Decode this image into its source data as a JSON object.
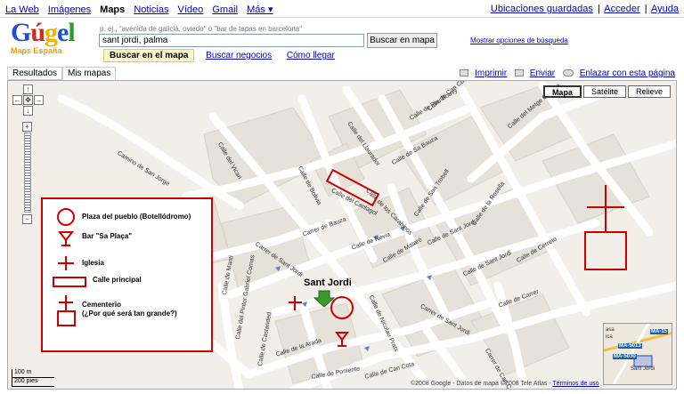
{
  "topnav": {
    "left": [
      "La Web",
      "Imágenes",
      "Maps",
      "Noticias",
      "Vídeo",
      "Gmail",
      "Más ▾"
    ],
    "right": [
      "Ubicaciones guardadas",
      "Acceder",
      "Ayuda"
    ],
    "separator": "|"
  },
  "logo": {
    "wordmark": "Gúgel",
    "sub": "Maps España"
  },
  "search": {
    "hint": "p. ej., \"avenida de galicia, oviedo\" o \"bar de tapas en barcelona\"",
    "value": "sant jordi, palma",
    "button": "Buscar en mapa",
    "options_link": "Mostrar opciones de búsqueda"
  },
  "subtabs": {
    "active": "Buscar en el mapa",
    "others": [
      "Buscar negocios",
      "Cómo llegar"
    ]
  },
  "panel_tabs": [
    "Resultados",
    "Mis mapas"
  ],
  "actions": {
    "print": "Imprimir",
    "send": "Enviar",
    "link": "Enlazar con esta página"
  },
  "map_types": [
    "Mapa",
    "Satélite",
    "Relieve"
  ],
  "selected_map_type": "Mapa",
  "legend": {
    "plaza": "Plaza del pueblo (Botellódromo)",
    "bar": "Bar \"Sa Plaça\"",
    "church": "Iglesia",
    "street": "Calle principal",
    "cemetery_1": "Cementerio",
    "cemetery_2": "(¿Por qué será tan grande?)"
  },
  "place_name": "Sant Jordi",
  "streets": {
    "s1": "Camino de San Jorge",
    "s2": "Calle del Vicari",
    "s3": "Calle de Bolivia",
    "s4": "Calle del Llaurador",
    "s5": "Calle de Sa Bauza",
    "s6": "Calle del Cantagol",
    "s7": "Calle de los Carabinos",
    "s8": "Calle de Son Trobell",
    "s9": "Calle de Pau Bouvy",
    "s10": "Calle de Can Conet",
    "s11": "Calle del Metge Clavero",
    "s12": "Carrer de Bauza",
    "s13": "Calle de Nevia",
    "s14": "Calle de Mataró",
    "s15": "Calle de la Rosella",
    "s16": "Calle de Carrer",
    "s17": "Calle de Cerreto",
    "s18": "Calle de Mantí",
    "s19": "Calle del Pintor Gabriel Comas",
    "s20": "Carrer de Sant Jordi",
    "s21": "Calle de Nicolau Prats",
    "s22": "Calle de Poniente",
    "s23": "Calle de la Arada",
    "s24": "Calle de Can Cota",
    "s25": "Calle de Castanded",
    "s26": "Carrer de Sant Jordi",
    "s27": "Carrer de Can Cota",
    "s28": "Calle de Sant Jordi",
    "s29": "Calle de Sant Jordi"
  },
  "scale": {
    "metric": "100 m",
    "imperial": "200 pies"
  },
  "copyright": "©2008 Google - Datos de mapa ©2008 Tele Atlas -",
  "terms_link": "Términos de uso",
  "overview": {
    "a": "MA-15",
    "b": "MA-5013",
    "c": "MA-5030",
    "d": "Sant Jordi",
    "e": "asa",
    "f": "ica"
  },
  "colors": {
    "annotation": "#cc0000",
    "road": "#ffffff",
    "map_bg": "#f2efe9",
    "block": "#e6e2da",
    "marker": "#3a9a2a"
  }
}
